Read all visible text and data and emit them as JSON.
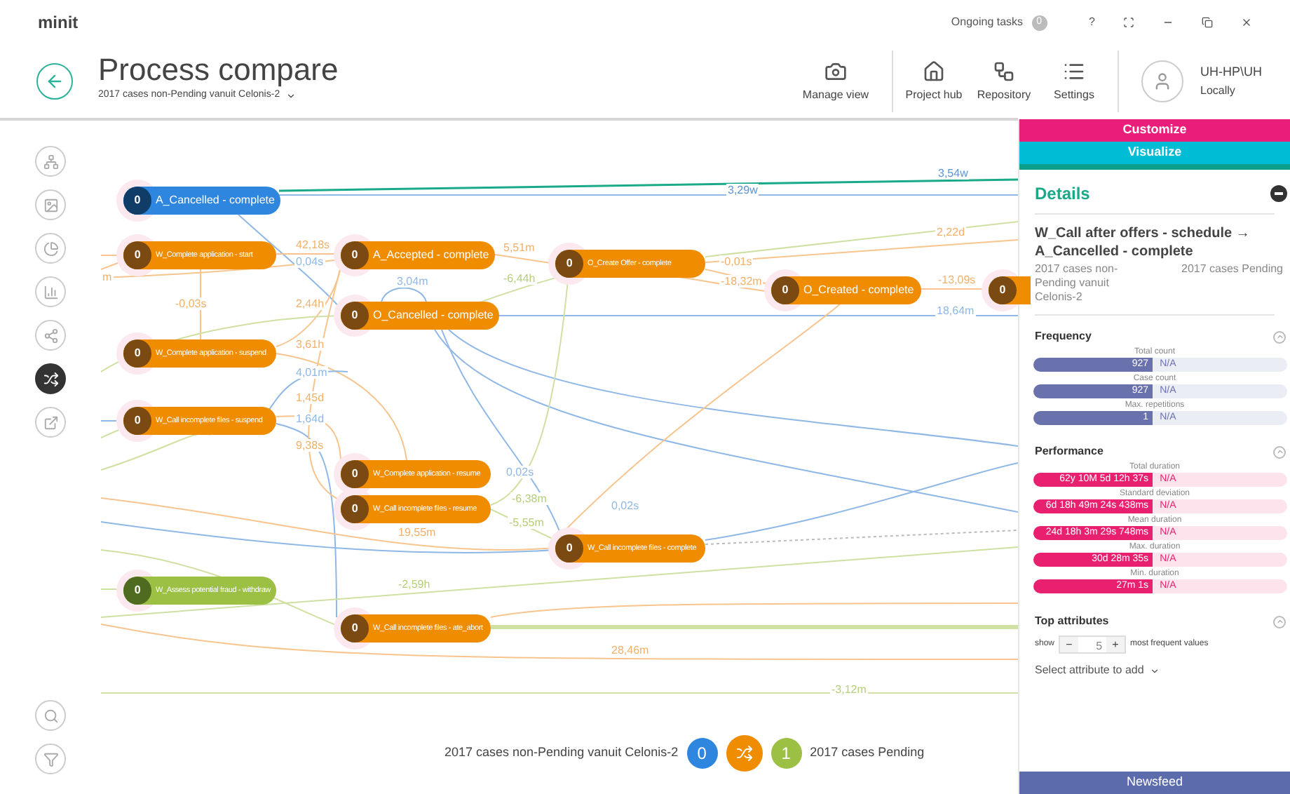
{
  "app": {
    "logo": "minit",
    "ongoing_tasks": "Ongoing tasks",
    "tasks_count": "0",
    "help": "?"
  },
  "header": {
    "title": "Process compare",
    "subtitle": "2017 cases non-Pending vanuit Celonis-2",
    "user": "UH-HP\\UH",
    "user_location": "Locally"
  },
  "toolbar": [
    {
      "label": "Manage view",
      "kind": "manage"
    },
    {
      "label": "Project hub",
      "kind": "home"
    },
    {
      "label": "Repository",
      "kind": "repository"
    },
    {
      "label": "Settings",
      "kind": "settings"
    }
  ],
  "tools": [
    {
      "kind": "hierarchy",
      "selected": false
    },
    {
      "kind": "image",
      "selected": false
    },
    {
      "kind": "pie",
      "selected": false
    },
    {
      "kind": "chart",
      "selected": false
    },
    {
      "kind": "flow",
      "selected": false
    },
    {
      "kind": "shuffle",
      "selected": true
    },
    {
      "kind": "export",
      "selected": false
    },
    {
      "kind": "search",
      "selected": false
    },
    {
      "kind": "filter",
      "selected": false
    }
  ],
  "nodes": [
    {
      "label": "A_Cancelled - complete",
      "count": "0",
      "color": "#2e86de"
    },
    {
      "label": "W_Complete application - start",
      "count": "0",
      "color": "#f08c00"
    },
    {
      "label": "A_Accepted - complete",
      "count": "0",
      "color": "#f08c00"
    },
    {
      "label": "O_Cancelled - complete",
      "count": "0",
      "color": "#f08c00"
    },
    {
      "label": "W_Complete application - suspend",
      "count": "0",
      "color": "#f08c00"
    },
    {
      "label": "W_Call incomplete files - suspend",
      "count": "0",
      "color": "#f08c00"
    },
    {
      "label": "W_Complete application - resume",
      "count": "0",
      "color": "#f08c00"
    },
    {
      "label": "W_Call incomplete files - resume",
      "count": "0",
      "color": "#f08c00"
    },
    {
      "label": "W_Call incomplete files - complete",
      "count": "0",
      "color": "#f08c00"
    },
    {
      "label": "W_Assess potential fraud - withdraw",
      "count": "0",
      "color": "#9bc043"
    },
    {
      "label": "W_Call incomplete files - ate_abort",
      "count": "0",
      "color": "#f08c00"
    },
    {
      "label": "O_Create Offer - complete",
      "count": "0",
      "color": "#f08c00"
    },
    {
      "label": "O_Created - complete",
      "count": "0",
      "color": "#f08c00"
    },
    {
      "count": "0",
      "color": "#f08c00"
    }
  ],
  "edge_labels": [
    {
      "text": "3,54w",
      "color": "#5b95d6"
    },
    {
      "text": "3,29w",
      "color": "#5b95d6"
    },
    {
      "text": "42,18s",
      "color": "#f2b06a"
    },
    {
      "text": "0,04s",
      "color": "#8fb8e6"
    },
    {
      "text": "5,51m",
      "color": "#f2b06a"
    },
    {
      "text": "3,04m",
      "color": "#8fb8e6"
    },
    {
      "text": "-6,44h",
      "color": "#b5cf7a"
    },
    {
      "text": "-0,03s",
      "color": "#f2b06a"
    },
    {
      "text": "2,44h",
      "color": "#f2b06a"
    },
    {
      "text": "2,22d",
      "color": "#f2b06a"
    },
    {
      "text": "-0,01s",
      "color": "#f2b06a"
    },
    {
      "text": "-18,32m",
      "color": "#f2b06a"
    },
    {
      "text": "-13,09s",
      "color": "#f2b06a"
    },
    {
      "text": "18,64m",
      "color": "#8fb8e6"
    },
    {
      "text": "3,61h",
      "color": "#f2b06a"
    },
    {
      "text": "4,01m",
      "color": "#8fb8e6"
    },
    {
      "text": "1,45d",
      "color": "#f2b06a"
    },
    {
      "text": "1,64d",
      "color": "#8fb8e6"
    },
    {
      "text": "9,38s",
      "color": "#f2b06a"
    },
    {
      "text": "0,02s",
      "color": "#8fb8e6"
    },
    {
      "text": "0,02s",
      "color": "#8fb8e6"
    },
    {
      "text": "-6,38m",
      "color": "#b5cf7a"
    },
    {
      "text": "19,55m",
      "color": "#f2b06a"
    },
    {
      "text": "-5,55m",
      "color": "#b5cf7a"
    },
    {
      "text": "-2,59h",
      "color": "#b5cf7a"
    },
    {
      "text": "28,46m",
      "color": "#f2b06a"
    },
    {
      "text": "-3,12m",
      "color": "#b5cf7a"
    },
    {
      "text": "m",
      "color": "#f2b06a"
    }
  ],
  "legend": {
    "left": "2017 cases non-Pending vanuit Celonis-2",
    "left_count": "0",
    "right_count": "1",
    "right": "2017 cases Pending"
  },
  "panel": {
    "buttons": [
      {
        "label": "Customize",
        "kind": "customize"
      },
      {
        "label": "Visualize",
        "kind": "visualize"
      }
    ],
    "title": "Details",
    "heading": "W_Call after offers - schedule → A_Cancelled - complete",
    "left_caption": "2017 cases non-Pending vanuit Celonis-2",
    "right_caption": "2017 cases Pending",
    "sections": [
      {
        "title": "Frequency",
        "kind": "frequency",
        "expanded": true,
        "metrics": [
          {
            "label": "Total count",
            "value": "927",
            "compare": "N/A",
            "level": 0.47
          },
          {
            "label": "Case count",
            "value": "927",
            "compare": "N/A",
            "level": 0.47
          },
          {
            "label": "Max. repetitions",
            "value": "1",
            "compare": "N/A",
            "level": 0.47
          }
        ]
      },
      {
        "title": "Performance",
        "kind": "performance",
        "expanded": true,
        "metrics": [
          {
            "label": "Total duration",
            "value": "62y 10M 5d 12h 37s",
            "compare": "N/A",
            "level": 0.47
          },
          {
            "label": "Standard deviation",
            "value": "6d 18h 49m 24s 438ms",
            "compare": "N/A",
            "level": 0.47
          },
          {
            "label": "Mean duration",
            "value": "24d 18h 3m 29s 748ms",
            "compare": "N/A",
            "level": 0.47
          },
          {
            "label": "Max. duration",
            "value": "30d 28m 35s",
            "compare": "N/A",
            "level": 0.47
          },
          {
            "label": "Min. duration",
            "value": "27m 1s",
            "compare": "N/A",
            "level": 0.47
          }
        ]
      }
    ],
    "top_attributes": {
      "title": "Top attributes",
      "expanded": true,
      "show": "show",
      "minus": "−",
      "value": "5",
      "plus": "+",
      "suffix": "most frequent values",
      "select": "Select attribute to add"
    },
    "newsfeed": "Newsfeed"
  }
}
